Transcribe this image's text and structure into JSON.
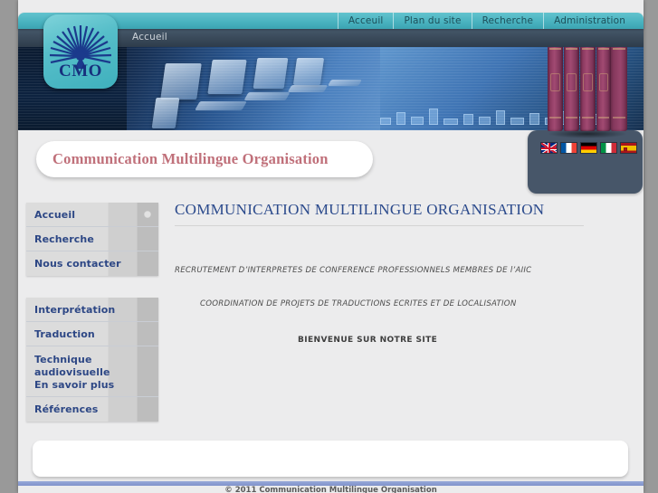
{
  "topnav": {
    "items": [
      {
        "label": "Acceuil",
        "name": "topnav-acceuil"
      },
      {
        "label": "Plan du site",
        "name": "topnav-plan-du-site"
      },
      {
        "label": "Recherche",
        "name": "topnav-recherche"
      },
      {
        "label": "Administration",
        "name": "topnav-administration"
      }
    ]
  },
  "breadcrumb": {
    "current": "Accueil"
  },
  "logo": {
    "text": "CMO",
    "alt": "CMO sunburst logo"
  },
  "site_title": "Communication Multilingue Organisation",
  "languages": [
    {
      "name": "flag-en",
      "label": "English"
    },
    {
      "name": "flag-fr",
      "label": "Français"
    },
    {
      "name": "flag-de",
      "label": "Deutsch"
    },
    {
      "name": "flag-it",
      "label": "Italiano"
    },
    {
      "name": "flag-es",
      "label": "Español"
    }
  ],
  "sidebar": {
    "block1": [
      {
        "label": "Accueil",
        "name": "sidebar-item-accueil",
        "active": true
      },
      {
        "label": "Recherche",
        "name": "sidebar-item-recherche",
        "active": false
      },
      {
        "label": "Nous contacter",
        "name": "sidebar-item-nous-contacter",
        "active": false
      }
    ],
    "block2": [
      {
        "label": "Interprétation",
        "name": "sidebar-item-interpretation"
      },
      {
        "label": "Traduction",
        "name": "sidebar-item-traduction"
      },
      {
        "label_line1": "Technique",
        "label_line2": "audiovisuelle",
        "label_line3": "En savoir plus",
        "name": "sidebar-item-technique-audiovisuelle"
      },
      {
        "label": "Références",
        "name": "sidebar-item-references"
      }
    ]
  },
  "main": {
    "heading": "COMMUNICATION MULTILINGUE ORGANISATION",
    "para1": "RECRUTEMENT D’INTERPRETES DE CONFERENCE PROFESSIONNELS MEMBRES DE l’AIIC",
    "para2": "COORDINATION DE PROJETS DE TRADUCTIONS ECRITES ET DE LOCALISATION",
    "para3": "BIENVENUE SUR NOTRE SITE"
  },
  "footer": {
    "copyright": "© 2011 Communication Multilingue Organisation"
  },
  "colors": {
    "teal": "#4ab3c0",
    "page_bg": "#999999",
    "content_bg": "#ececed",
    "title_rose": "#c0707a",
    "heading_blue": "#2b4a8c",
    "menu_blue": "#2d4785",
    "footer_blue": "#8193cb",
    "book_purple": "#8d3a61",
    "panel_slate": "#475669"
  }
}
